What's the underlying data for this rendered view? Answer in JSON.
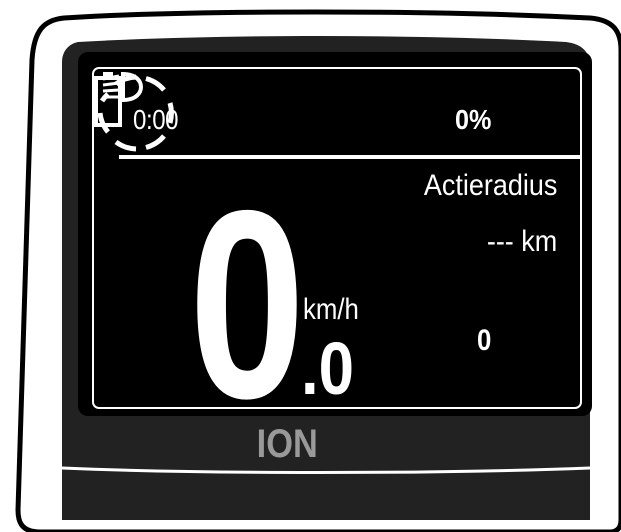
{
  "status_bar": {
    "trip_time": "0:00",
    "headlight_icon": "headlight-on-icon",
    "battery_percent": "0%",
    "battery_icon": "battery-empty-icon"
  },
  "range": {
    "label": "Actieradius",
    "value": "--- km"
  },
  "speed": {
    "integer": "0",
    "unit": "km/h",
    "decimal": ".0"
  },
  "assist": {
    "level": "0",
    "icon": "assist-level-ring-icon"
  },
  "brand": {
    "name": "ION"
  },
  "colors": {
    "screen_background": "#000000",
    "screen_text": "#ffffff",
    "brand_text": "#999999",
    "bezel": "#222222"
  }
}
